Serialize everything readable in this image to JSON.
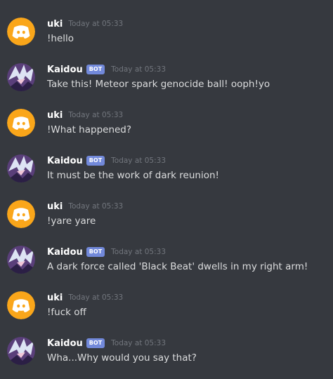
{
  "messages": [
    {
      "username": "uki",
      "is_bot": false,
      "timestamp": "Today at 05:33",
      "text": "!hello",
      "avatar_icon": "discord-logo-icon",
      "avatar_color": "#faa61a"
    },
    {
      "username": "Kaidou",
      "is_bot": true,
      "timestamp": "Today at 05:33",
      "text": "Take this! Meteor spark genocide ball! ooph!yo",
      "avatar_icon": "anime-character-icon"
    },
    {
      "username": "uki",
      "is_bot": false,
      "timestamp": "Today at 05:33",
      "text": "!What happened?",
      "avatar_icon": "discord-logo-icon",
      "avatar_color": "#faa61a"
    },
    {
      "username": "Kaidou",
      "is_bot": true,
      "timestamp": "Today at 05:33",
      "text": "It must be the work of dark reunion!",
      "avatar_icon": "anime-character-icon"
    },
    {
      "username": "uki",
      "is_bot": false,
      "timestamp": "Today at 05:33",
      "text": "!yare yare",
      "avatar_icon": "discord-logo-icon",
      "avatar_color": "#faa61a"
    },
    {
      "username": "Kaidou",
      "is_bot": true,
      "timestamp": "Today at 05:33",
      "text": "A dark force called 'Black Beat' dwells in my right arm!",
      "avatar_icon": "anime-character-icon"
    },
    {
      "username": "uki",
      "is_bot": false,
      "timestamp": "Today at 05:33",
      "text": "!fuck off",
      "avatar_icon": "discord-logo-icon",
      "avatar_color": "#faa61a"
    },
    {
      "username": "Kaidou",
      "is_bot": true,
      "timestamp": "Today at 05:33",
      "text": "Wha...Why would you say that?",
      "avatar_icon": "anime-character-icon"
    }
  ],
  "bot_tag_label": "BOT",
  "colors": {
    "background": "#36393f",
    "bot_tag": "#7289da",
    "username": "#ffffff",
    "timestamp": "#72767d",
    "message_text": "#dcddde"
  }
}
